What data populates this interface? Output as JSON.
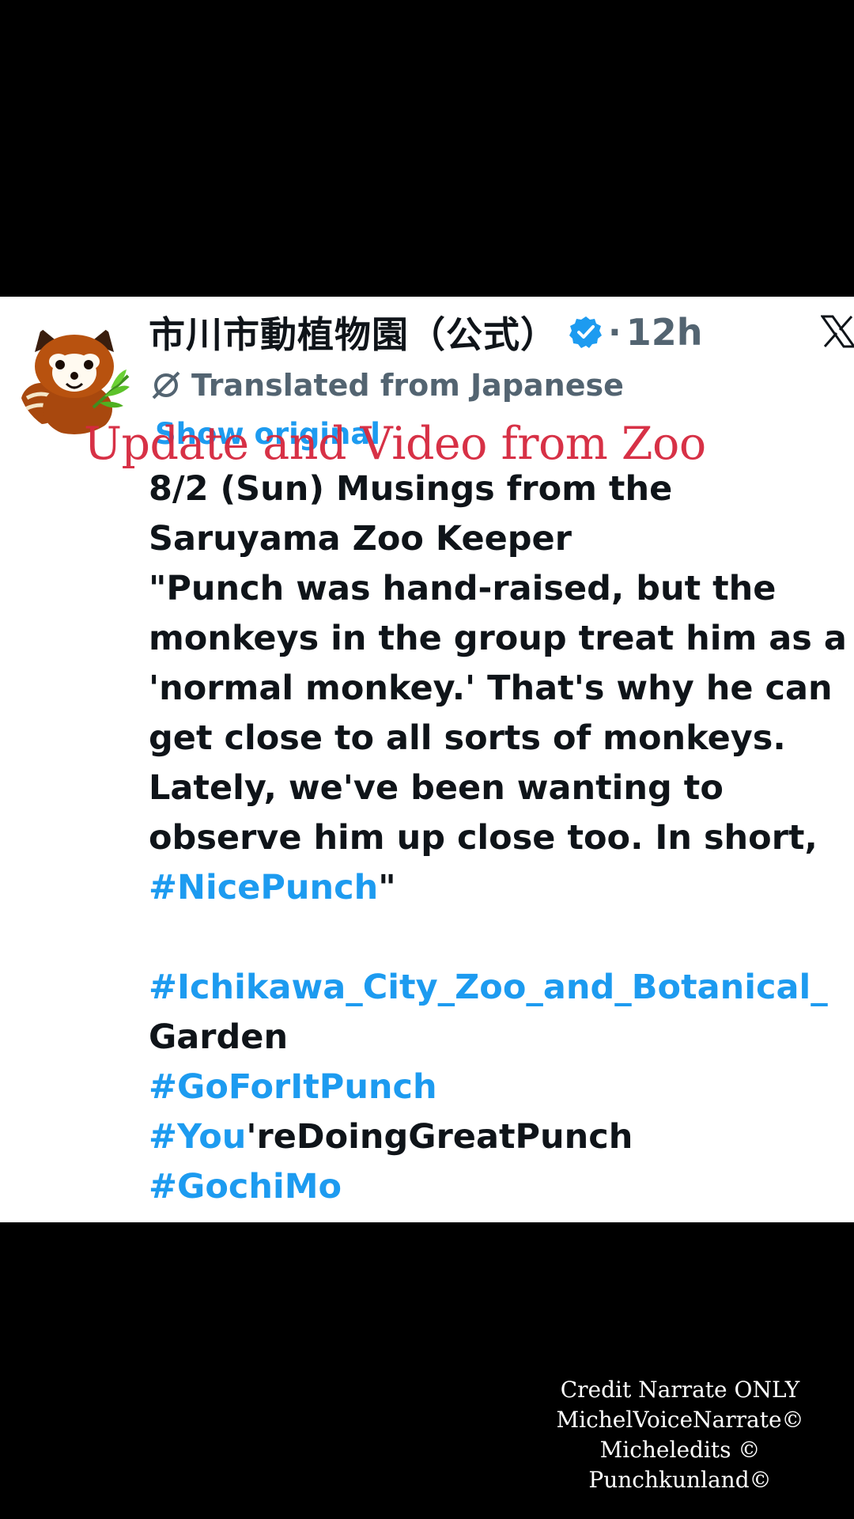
{
  "tweet": {
    "account_name": "市川市動植物園（公式）",
    "separator": "·",
    "timestamp": "12h",
    "translation_notice": "Translated from Japanese",
    "show_original": "Show original",
    "lines": [
      [
        {
          "text": "8/2 (Sun) Musings from the"
        }
      ],
      [
        {
          "text": "Saruyama Zoo Keeper"
        }
      ],
      [
        {
          "text": "\"Punch was hand-raised, but the"
        }
      ],
      [
        {
          "text": "monkeys in the group treat him as a"
        }
      ],
      [
        {
          "text": "'normal monkey.' That's why he can"
        }
      ],
      [
        {
          "text": "get close to all sorts of monkeys."
        }
      ],
      [
        {
          "text": "Lately, we've been wanting to"
        }
      ],
      [
        {
          "text": "observe him up close too. In short,"
        }
      ],
      [
        {
          "text": "#NicePunch"
        },
        {
          "text": "\""
        }
      ],
      [],
      [
        {
          "text": "#Ichikawa_City_Zoo_and_Botanical_"
        }
      ],
      [
        {
          "text": "Garden"
        }
      ],
      [
        {
          "text": "#GoForItPunch"
        }
      ],
      [
        {
          "text": "#You"
        },
        {
          "text": "'reDoingGreatPunch"
        }
      ],
      [
        {
          "text": "#GochiMo"
        }
      ]
    ],
    "hashtag_color": "#1d9bf0"
  },
  "overlay": {
    "title": "Update and Video from Zoo",
    "title_color": "#d6293f"
  },
  "credits": {
    "line1": "Credit Narrate ONLY",
    "line2": "MichelVoiceNarrate©",
    "line3": "Micheledits ©",
    "line4": "Punchkunland©"
  },
  "icons": {
    "avatar": "red-panda-avatar-icon",
    "verified": "verified-badge-icon",
    "platform": "x-logo-icon",
    "translate": "translate-icon"
  },
  "colors": {
    "text": "#0f1419",
    "muted": "#536471",
    "accent": "#1d9bf0",
    "background": "#ffffff",
    "letterbox": "#000000"
  }
}
